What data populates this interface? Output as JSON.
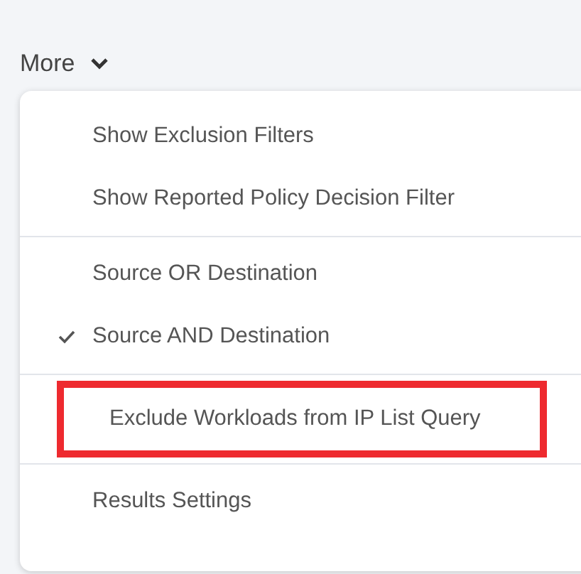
{
  "more_button": {
    "label": "More",
    "expanded": true
  },
  "menu": {
    "sections": [
      {
        "items": [
          {
            "kind": "action",
            "label": "Show Exclusion Filters",
            "highlighted": false
          },
          {
            "kind": "action",
            "label": "Show Reported Policy Decision Filter",
            "highlighted": false
          }
        ]
      },
      {
        "items": [
          {
            "kind": "option",
            "label": "Source OR Destination",
            "checked": false,
            "highlighted": false
          },
          {
            "kind": "option",
            "label": "Source AND Destination",
            "checked": true,
            "highlighted": false
          }
        ]
      },
      {
        "items": [
          {
            "kind": "action",
            "label": "Exclude Workloads from IP List Query",
            "highlighted": true
          }
        ]
      },
      {
        "items": [
          {
            "kind": "action",
            "label": "Results Settings",
            "highlighted": false
          }
        ]
      }
    ]
  }
}
